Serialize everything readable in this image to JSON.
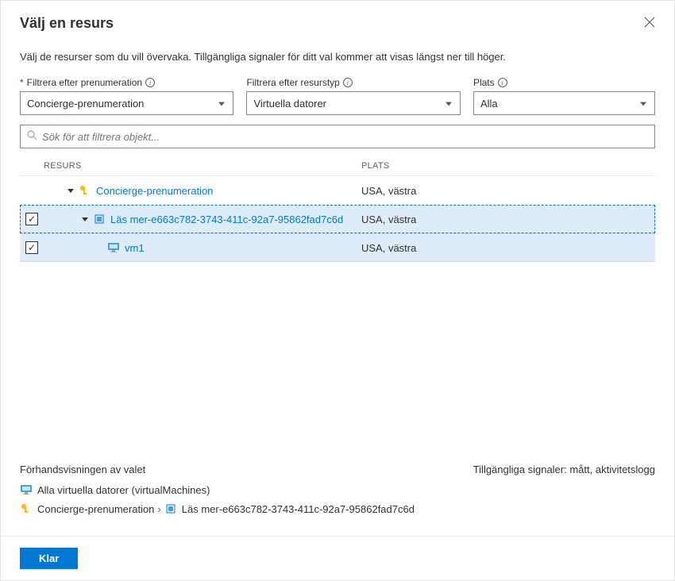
{
  "header": {
    "title": "Välj en resurs"
  },
  "description": "Välj de resurser som du vill övervaka. Tillgängliga signaler för ditt val kommer att visas längst ner till höger.",
  "filters": {
    "subscription": {
      "label": "Filtrera efter prenumeration",
      "value": "Concierge-prenumeration",
      "required": true
    },
    "resourceType": {
      "label": "Filtrera efter resurstyp",
      "value": "Virtuella datorer"
    },
    "location": {
      "label": "Plats",
      "value": "Alla"
    }
  },
  "search": {
    "placeholder": "Sök för att filtrera objekt..."
  },
  "columns": {
    "resource": "Resurs",
    "location": "Plats"
  },
  "rows": [
    {
      "name": "Concierge-prenumeration",
      "location": "USA, västra"
    },
    {
      "name": "Läs mer-e663c782-3743-411c-92a7-95862fad7c6d",
      "location": "USA, västra"
    },
    {
      "name": "vm1",
      "location": "USA, västra"
    }
  ],
  "preview": {
    "title": "Förhandsvisningen av valet",
    "signals": "Tillgängliga signaler: mått, aktivitetslogg",
    "allVms": "Alla virtuella datorer (virtualMachines)",
    "crumb1": "Concierge-prenumeration",
    "crumb2": "Läs mer-e663c782-3743-411c-92a7-95862fad7c6d"
  },
  "footer": {
    "done": "Klar"
  },
  "checkmark": "✓"
}
